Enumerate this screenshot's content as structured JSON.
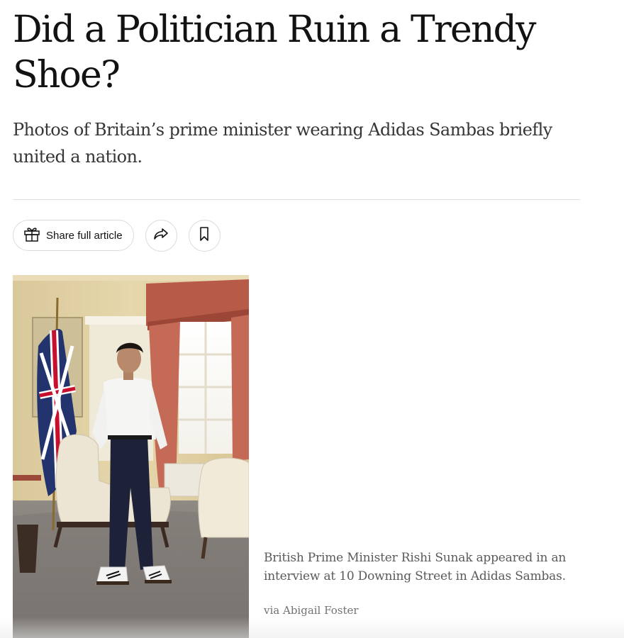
{
  "article": {
    "headline": "Did a Politician Ruin a Trendy Shoe?",
    "summary": "Photos of Britain’s prime minister wearing Adidas Sambas briefly united a nation."
  },
  "toolbar": {
    "share_full_label": "Share full article",
    "icons": [
      "gift-icon",
      "share-arrow-icon",
      "bookmark-icon"
    ]
  },
  "photo": {
    "caption": "British Prime Minister Rishi Sunak appeared in an interview at 10 Downing Street in Adidas Sambas.",
    "credit": "via Abigail Foster"
  },
  "colors": {
    "text": "#121212",
    "summary_text": "#363636",
    "caption_text": "#5a5a5a",
    "rule": "#dfdfdf"
  }
}
